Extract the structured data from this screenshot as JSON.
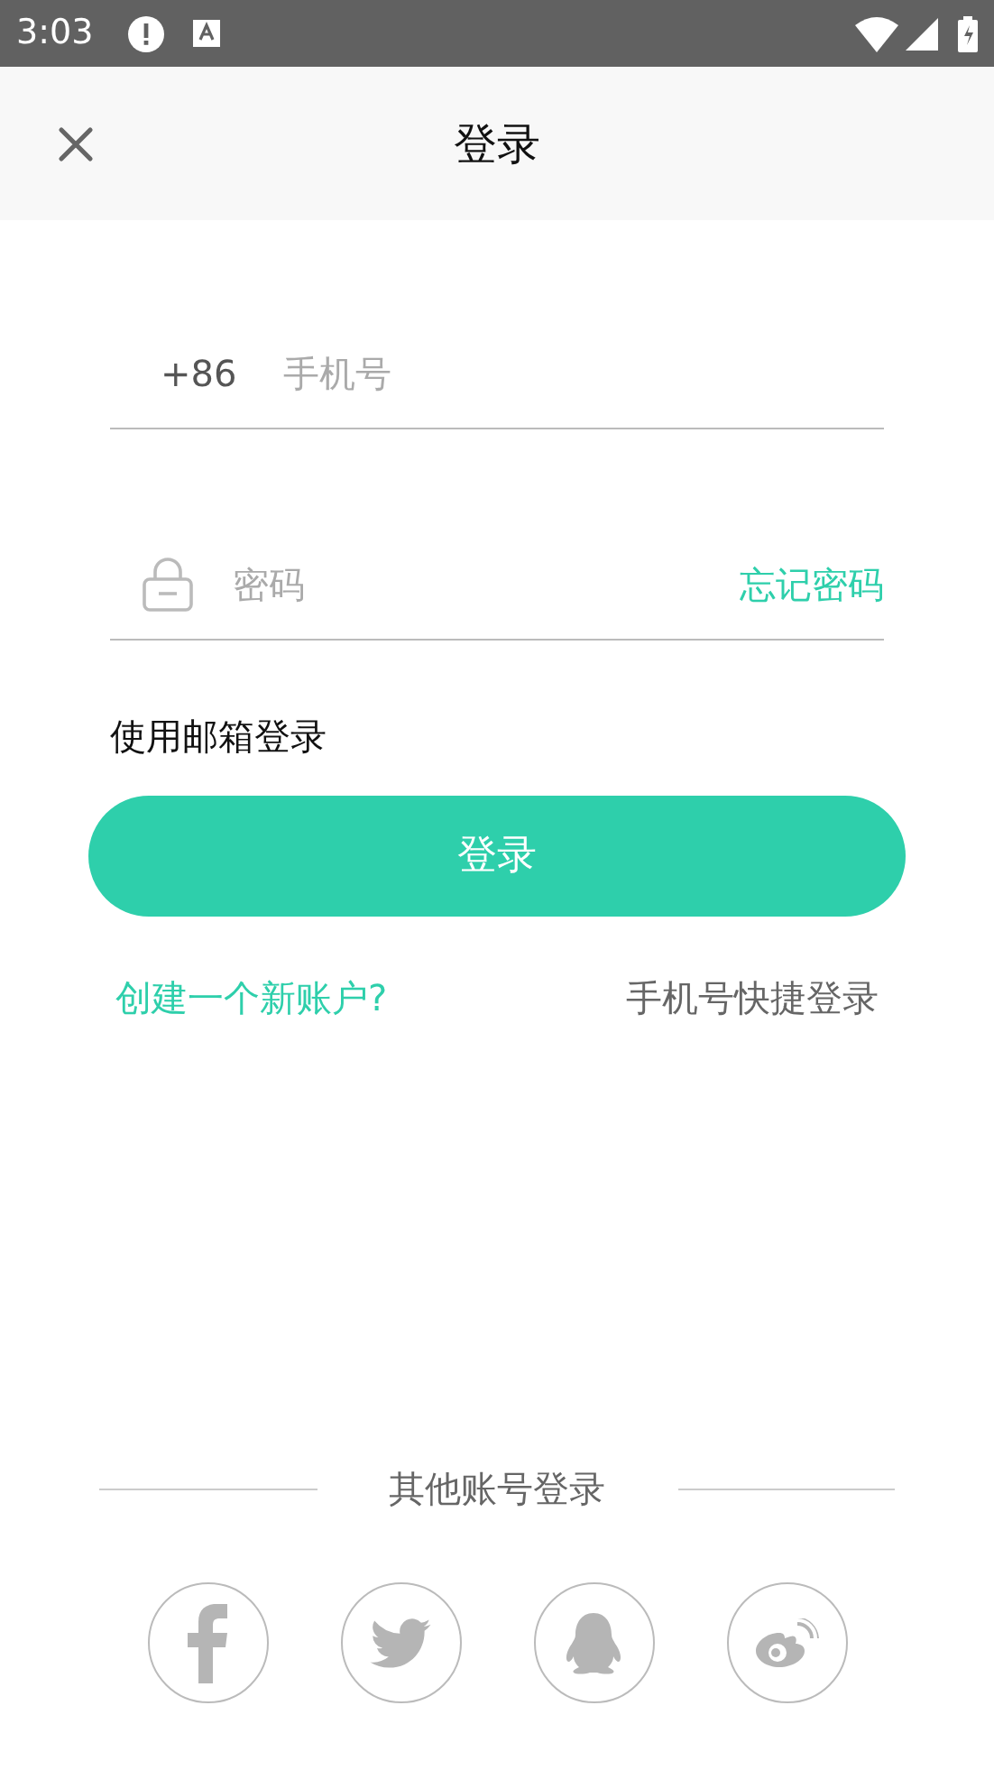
{
  "status_bar": {
    "time": "3:03"
  },
  "header": {
    "title": "登录"
  },
  "phone": {
    "country_code": "+86",
    "placeholder": "手机号"
  },
  "password": {
    "placeholder": "密码",
    "forgot": "忘记密码"
  },
  "email_login": "使用邮箱登录",
  "login_button": "登录",
  "create_account": "创建一个新账户?",
  "quick_login": "手机号快捷登录",
  "other_login": {
    "title": "其他账号登录",
    "providers": [
      {
        "kind": "facebook"
      },
      {
        "kind": "twitter"
      },
      {
        "kind": "qq"
      },
      {
        "kind": "weibo"
      }
    ]
  }
}
